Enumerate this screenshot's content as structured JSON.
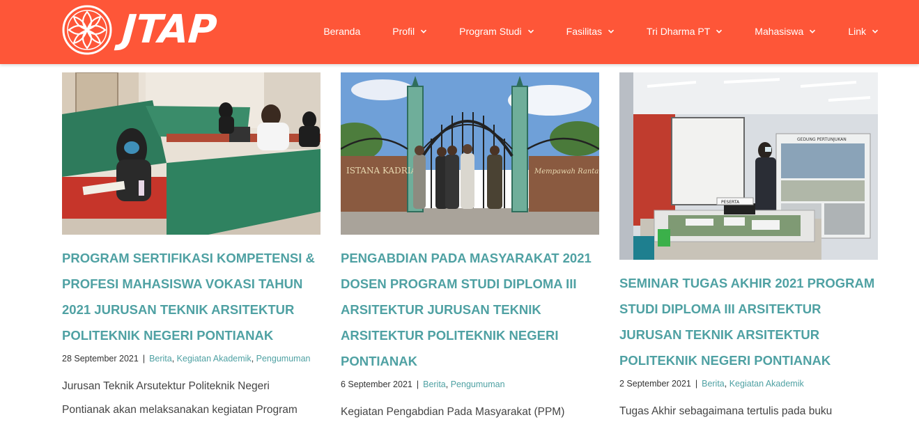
{
  "brand": {
    "logo_text": "JTAP"
  },
  "colors": {
    "header": "#fe5638",
    "accent": "#4fa1a3"
  },
  "nav": [
    {
      "label": "Beranda",
      "has_dropdown": false
    },
    {
      "label": "Profil",
      "has_dropdown": true
    },
    {
      "label": "Program Studi",
      "has_dropdown": true
    },
    {
      "label": "Fasilitas",
      "has_dropdown": true
    },
    {
      "label": "Tri Dharma PT",
      "has_dropdown": true
    },
    {
      "label": "Mahasiswa",
      "has_dropdown": true
    },
    {
      "label": "Link",
      "has_dropdown": true
    }
  ],
  "posts": [
    {
      "title": "PROGRAM SERTIFIKASI KOMPETENSI & PROFESI MAHASISWA VOKASI TAHUN 2021 JURUSAN TEKNIK ARSITEKTUR POLITEKNIK NEGERI PONTIANAK",
      "date": "28 September 2021",
      "separator": "|",
      "categories": [
        "Berita",
        "Kegiatan Akademik",
        "Pengumuman"
      ],
      "excerpt": "Jurusan Teknik Arsutektur Politeknik Negeri Pontianak akan melaksanakan kegiatan Program"
    },
    {
      "title": "PENGABDIAN PADA MASYARAKAT 2021 DOSEN PROGRAM STUDI DIPLOMA III ARSITEKTUR JURUSAN TEKNIK ARSITEKTUR POLITEKNIK NEGERI PONTIANAK",
      "date": "6 September 2021",
      "separator": "|",
      "categories": [
        "Berita",
        "Pengumuman"
      ],
      "excerpt": "Kegiatan Pengabdian Pada Masyarakat (PPM)",
      "image_signage": {
        "left": "ISTANA KADRIAH",
        "right": "Mempawah Rantau Bahagia"
      }
    },
    {
      "title": "SEMINAR TUGAS AKHIR 2021 PROGRAM STUDI DIPLOMA III ARSITEKTUR JURUSAN TEKNIK ARSITEKTUR POLITEKNIK NEGERI PONTIANAK",
      "date": "2 September 2021",
      "separator": "|",
      "categories": [
        "Berita",
        "Kegiatan Akademik"
      ],
      "excerpt": "Tugas Akhir sebagaimana tertulis pada buku",
      "image_signage": {
        "poster": "GEDUNG PERTUNJUKAN",
        "desk": "PESERTA"
      }
    }
  ]
}
